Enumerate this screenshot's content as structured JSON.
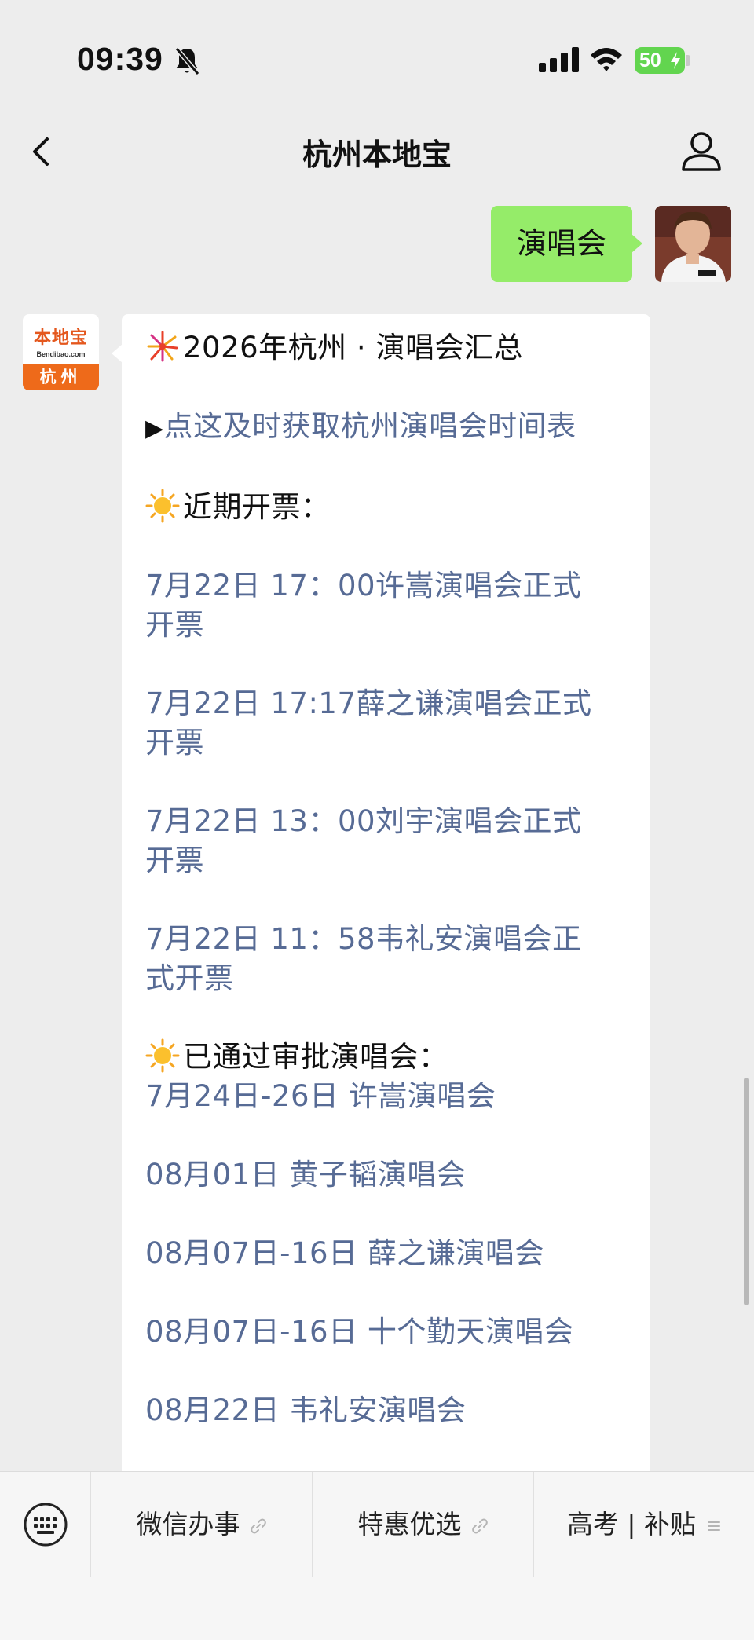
{
  "status_bar": {
    "time": "09:39",
    "battery": "50",
    "icons": [
      "mute-bell-icon",
      "signal-icon",
      "wifi-icon",
      "battery-charging-icon"
    ]
  },
  "nav": {
    "title": "杭州本地宝",
    "back_icon": "chevron-left-icon",
    "profile_icon": "person-icon"
  },
  "chat": {
    "user_message": "演唱会",
    "bot_avatar": {
      "logo_cn": "本地宝",
      "logo_en": "Bendibao.com",
      "city": "杭州"
    },
    "bot_message": {
      "title": "2026年杭州 · 演唱会汇总",
      "link_arrow": "▶",
      "link_text": "点这及时获取杭州演唱会时间表",
      "section1_title": "近期开票：",
      "section1_items": [
        [
          "7月22日 17：00许嵩演唱会正式",
          "开票"
        ],
        [
          "7月22日 17:17薛之谦演唱会正式",
          "开票"
        ],
        [
          "7月22日 13：00刘宇演唱会正式",
          "开票"
        ],
        [
          "7月22日 11：58韦礼安演唱会正",
          "式开票"
        ]
      ],
      "section2_title": "已通过审批演唱会：",
      "section2_items": [
        "7月24日-26日 许嵩演唱会",
        "08月01日 黄子韬演唱会",
        "08月07日-16日 薛之谦演唱会",
        "08月07日-16日 十个勤天演唱会",
        "08月22日 韦礼安演唱会"
      ]
    }
  },
  "bottom_menu": {
    "keyboard_icon": "keyboard-icon",
    "items": [
      {
        "label": "微信办事",
        "icon": "link-icon"
      },
      {
        "label": "特惠优选",
        "icon": "link-icon"
      },
      {
        "label": "高考 | 补贴",
        "icon": "submenu-lines-icon"
      }
    ]
  },
  "colors": {
    "background": "#ededed",
    "user_bubble": "#95ec69",
    "link": "#576b95",
    "battery": "#62d54f",
    "brand_orange": "#ee6a1a"
  }
}
